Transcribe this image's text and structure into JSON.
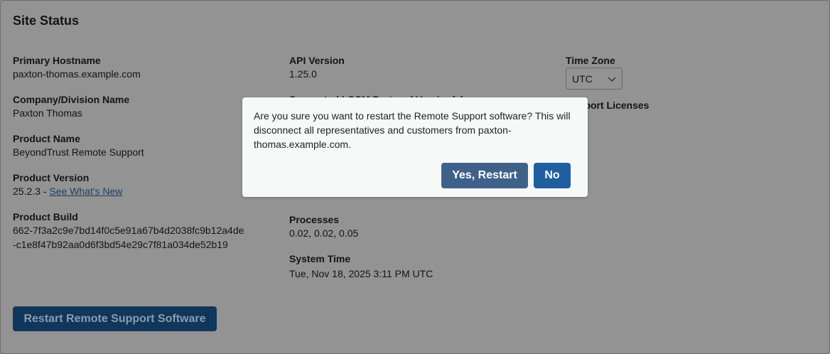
{
  "title": "Site Status",
  "col1": [
    {
      "label": "Primary Hostname",
      "value": "paxton-thomas.example.com"
    },
    {
      "label": "Company/Division Name",
      "value": "Paxton Thomas"
    },
    {
      "label": "Product Name",
      "value": "BeyondTrust Remote Support"
    },
    {
      "label": "Product Version",
      "value": "25.2.3 - ",
      "link": "See What's New"
    },
    {
      "label": "Product Build",
      "value": "662-7f3a2c9e7bd14f0c5e91a67b4d2038fc9b12a4de-c1e8f47b92aa0d6f3bd54e29c7f81a034de52b19"
    }
  ],
  "col2": {
    "api_label": "API Version",
    "api_value": "1.25.0",
    "lscm_label": "Supported LSCM Protocol Version(s)",
    "processes_label": "Processes",
    "processes_value": "0.02, 0.02, 0.05",
    "time_label": "System Time",
    "time_value": "Tue, Nov 18, 2025 3:11 PM UTC"
  },
  "col3": {
    "tz_label": "Time Zone",
    "tz_value": "UTC",
    "licenses_label": "Support Licenses"
  },
  "restart_button": "Restart Remote Support Software",
  "modal": {
    "message": "Are you sure you want to restart the Remote Support software? This will disconnect all representatives and customers from paxton-thomas.example.com.",
    "yes": "Yes, Restart",
    "no": "No"
  }
}
